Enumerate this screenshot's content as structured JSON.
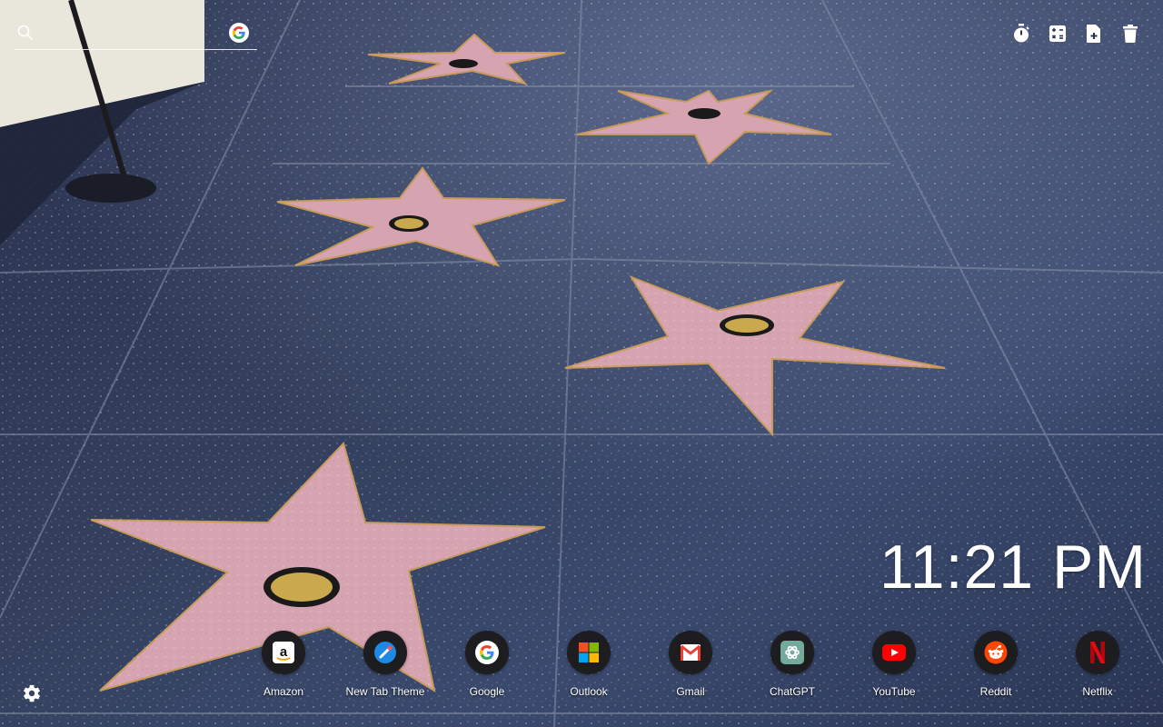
{
  "search": {
    "placeholder": "",
    "value": ""
  },
  "toolbar": {
    "items": [
      {
        "icon": "timer-icon"
      },
      {
        "icon": "calculator-icon"
      },
      {
        "icon": "new-note-icon"
      },
      {
        "icon": "trash-icon"
      }
    ]
  },
  "clock": {
    "time": "11:21 PM"
  },
  "shortcuts": [
    {
      "label": "Amazon",
      "icon": "amazon-icon"
    },
    {
      "label": "New Tab Theme",
      "icon": "new-tab-theme-icon"
    },
    {
      "label": "Google",
      "icon": "google-icon"
    },
    {
      "label": "Outlook",
      "icon": "outlook-icon"
    },
    {
      "label": "Gmail",
      "icon": "gmail-icon"
    },
    {
      "label": "ChatGPT",
      "icon": "chatgpt-icon"
    },
    {
      "label": "YouTube",
      "icon": "youtube-icon"
    },
    {
      "label": "Reddit",
      "icon": "reddit-icon"
    },
    {
      "label": "Netflix",
      "icon": "netflix-icon"
    }
  ],
  "settings": {
    "icon": "gear-icon"
  },
  "colors": {
    "ground": "#2a3552",
    "star": "#d6a3b0",
    "text": "#ffffff",
    "icon_bg": "#1d1d1f"
  }
}
